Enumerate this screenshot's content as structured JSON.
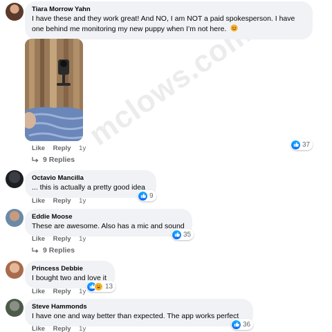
{
  "watermark": "mclows.com",
  "comments": [
    {
      "name": "Tiara Morrow Yahn",
      "text": "I have these and they work great! And NO, I am NOT a paid spokesperson. I have one behind me monitoring my new puppy when I’m not here.",
      "emoji": "smile-emoji",
      "like": "Like",
      "reply": "Reply",
      "time": "1y",
      "reaction_count": "37",
      "reaction_icons": [
        "like-icon"
      ]
    },
    {
      "name": "Octavio Mancilla",
      "text": "... this is actually a pretty good idea",
      "like": "Like",
      "reply": "Reply",
      "time": "1y",
      "reaction_count": "9",
      "reaction_icons": [
        "like-icon"
      ]
    },
    {
      "name": "Eddie Moose",
      "text": "These are awesome. Also has a mic and sound",
      "like": "Like",
      "reply": "Reply",
      "time": "1y",
      "reaction_count": "35",
      "reaction_icons": [
        "like-icon"
      ]
    },
    {
      "name": "Princess Debbie",
      "text": "I bought two and love it",
      "like": "Like",
      "reply": "Reply",
      "time": "1y",
      "reaction_count": "13",
      "reaction_icons": [
        "like-icon",
        "haha-icon"
      ]
    },
    {
      "name": "Steve Hammonds",
      "text": "I have one and way better than expected. The app works perfect",
      "like": "Like",
      "reply": "Reply",
      "time": "1y",
      "reaction_count": "36",
      "reaction_icons": [
        "like-icon"
      ]
    }
  ],
  "reply_threads": [
    {
      "label": "9 Replies"
    },
    {
      "label": "9 Replies"
    }
  ],
  "colors": {
    "bubble": "#f0f2f5",
    "like_blue": "#0866ff",
    "meta_gray": "#65676b"
  }
}
